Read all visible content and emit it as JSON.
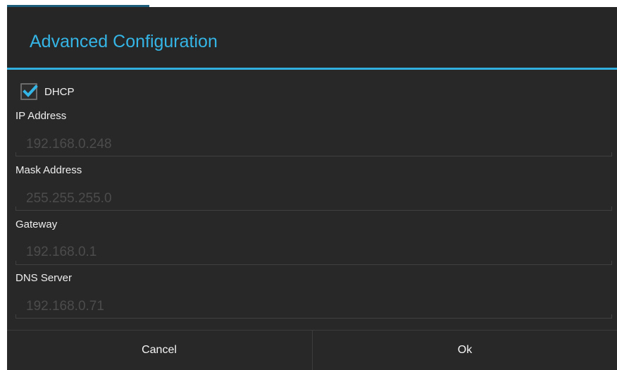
{
  "dialog": {
    "title": "Advanced Configuration",
    "accent_color": "#35b5e5"
  },
  "dhcp": {
    "label": "DHCP",
    "checked": true
  },
  "fields": [
    {
      "label": "IP Address",
      "value": "192.168.0.248"
    },
    {
      "label": "Mask Address",
      "value": "255.255.255.0"
    },
    {
      "label": "Gateway",
      "value": "192.168.0.1"
    },
    {
      "label": "DNS Server",
      "value": "192.168.0.71"
    }
  ],
  "buttons": {
    "cancel_label": "Cancel",
    "ok_label": "Ok"
  },
  "icons": {
    "checkbox": "check-icon"
  }
}
